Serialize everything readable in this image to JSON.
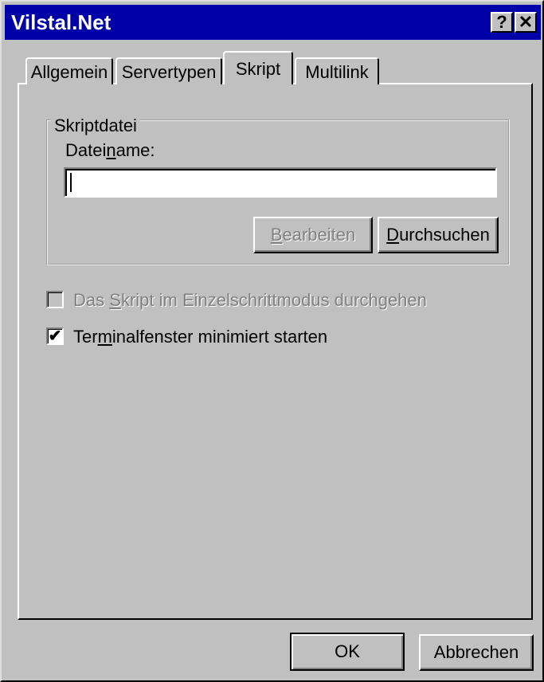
{
  "window": {
    "title": "Vilstal.Net",
    "help_glyph": "?",
    "close_glyph": "✕"
  },
  "tabs": [
    {
      "label": "Allgemein",
      "selected": false
    },
    {
      "label": "Servertypen",
      "selected": false
    },
    {
      "label": "Skript",
      "selected": true
    },
    {
      "label": "Multilink",
      "selected": false
    }
  ],
  "script_group": {
    "legend": "Skriptdatei",
    "filename_label_pre": "Datei",
    "filename_label_accel": "n",
    "filename_label_post": "ame:",
    "filename_value": "",
    "edit_button_accel": "B",
    "edit_button_rest": "earbeiten",
    "browse_button_accel": "D",
    "browse_button_rest": "urchsuchen"
  },
  "options": {
    "step_mode_pre": "Das ",
    "step_mode_accel": "S",
    "step_mode_post": "kript im Einzelschrittmodus durchgehen",
    "step_mode_checked": false,
    "step_mode_enabled": false,
    "terminal_pre": "Ter",
    "terminal_accel": "m",
    "terminal_post": "inalfenster minimiert starten",
    "terminal_checked": true,
    "check_glyph": "✔"
  },
  "footer": {
    "ok_label": "OK",
    "cancel_label": "Abbrechen"
  }
}
